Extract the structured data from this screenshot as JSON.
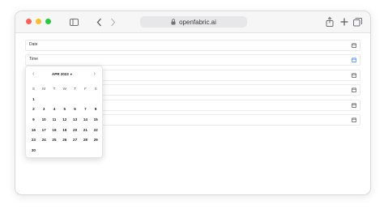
{
  "browser": {
    "url": "openfabric.ai",
    "icons": [
      "sidebar-icon",
      "back-icon",
      "forward-icon",
      "lock-icon",
      "share-icon",
      "new-tab-icon",
      "tabs-icon"
    ]
  },
  "form": {
    "fields": [
      {
        "label": "Date"
      },
      {
        "label": "Time"
      },
      {
        "label": ""
      },
      {
        "label": ""
      },
      {
        "label": ""
      },
      {
        "label": ""
      }
    ]
  },
  "datepicker": {
    "month_label": "APR 2023",
    "weekdays": [
      "S",
      "M",
      "T",
      "W",
      "T",
      "F",
      "S"
    ],
    "weeks": [
      [
        "1",
        "",
        "",
        "",
        "",
        "",
        ""
      ],
      [
        "2",
        "3",
        "4",
        "5",
        "6",
        "7",
        "8"
      ],
      [
        "9",
        "10",
        "11",
        "12",
        "13",
        "14",
        "15"
      ],
      [
        "16",
        "17",
        "18",
        "19",
        "20",
        "21",
        "22"
      ],
      [
        "23",
        "24",
        "25",
        "26",
        "27",
        "28",
        "29"
      ],
      [
        "30",
        "",
        "",
        "",
        "",
        "",
        ""
      ]
    ]
  }
}
